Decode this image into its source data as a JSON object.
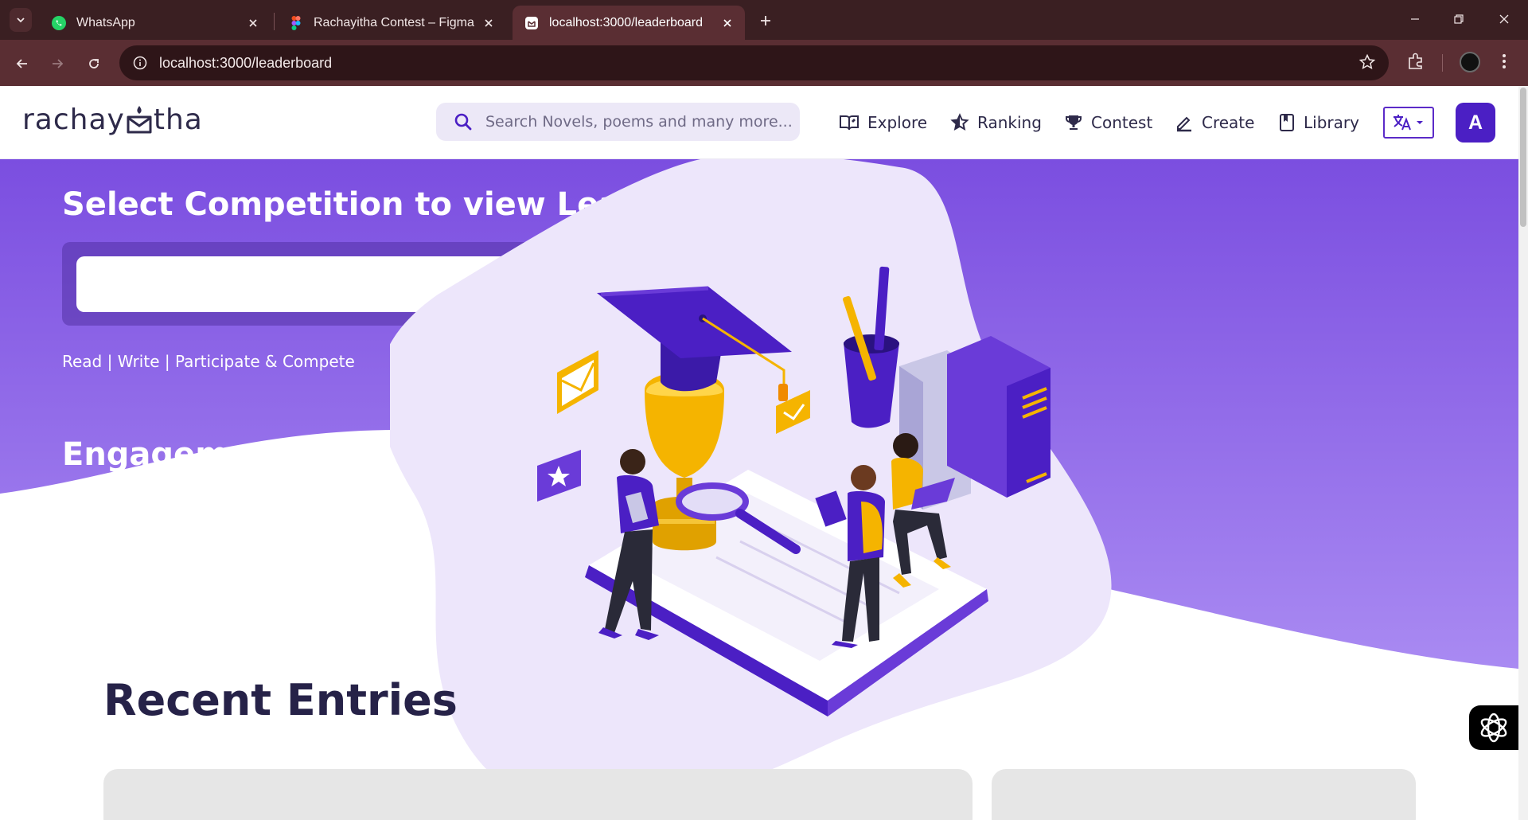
{
  "browser": {
    "tabs": [
      {
        "title": "WhatsApp",
        "icon": "whatsapp-icon"
      },
      {
        "title": "Rachayitha Contest – Figma",
        "icon": "figma-icon"
      },
      {
        "title": "localhost:3000/leaderboard",
        "icon": "site-icon",
        "active": true
      }
    ],
    "url": "localhost:3000/leaderboard"
  },
  "site": {
    "logo": {
      "left": "rachay",
      "right": "tha"
    },
    "search": {
      "placeholder": "Search Novels, poems and many more..."
    },
    "nav": [
      {
        "label": "Explore",
        "icon": "book-open-icon"
      },
      {
        "label": "Ranking",
        "icon": "star-icon"
      },
      {
        "label": "Contest",
        "icon": "trophy-icon"
      },
      {
        "label": "Create",
        "icon": "pen-icon"
      },
      {
        "label": "Library",
        "icon": "bookmark-book-icon"
      }
    ],
    "language_icon": "translate-icon",
    "avatar_initial": "A"
  },
  "hero": {
    "title": "Select Competition to view Leadership",
    "tagline": "Read | Write | Participate & Compete",
    "engagement_title": "Engagement Leaderboard",
    "illustration": "graduation-cap-trophy-books-students-illustration"
  },
  "recent": {
    "title": "Recent Entries"
  },
  "colors": {
    "brand": "#4b1fc4",
    "hero_gradient_top": "#7b4ee0",
    "hero_gradient_bottom": "#a98af2",
    "blob": "#ede6fb",
    "chrome_dark": "#3a1f22",
    "chrome_toolbar": "#5a2e33"
  }
}
